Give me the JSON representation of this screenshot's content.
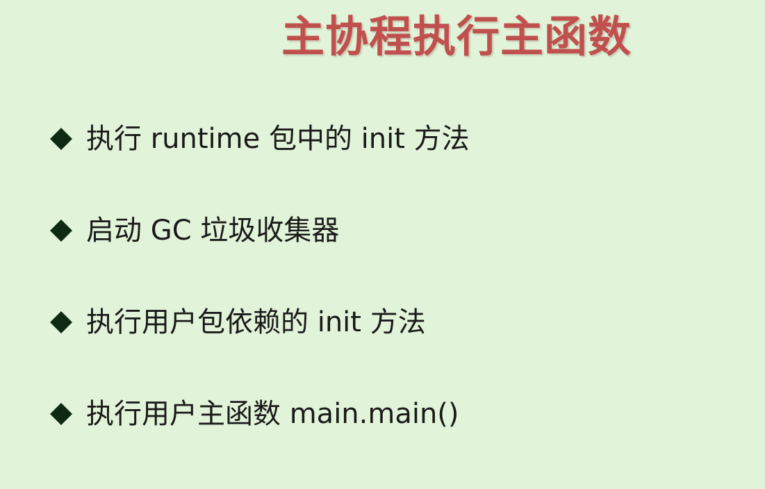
{
  "slide": {
    "title": "主协程执行主函数",
    "bullets": [
      {
        "icon": "diamond-bullet-icon",
        "text": "执行 runtime 包中的 init 方法"
      },
      {
        "icon": "diamond-bullet-icon",
        "text": "启动 GC 垃圾收集器"
      },
      {
        "icon": "diamond-bullet-icon",
        "text": "执行用户包依赖的 init 方法"
      },
      {
        "icon": "diamond-bullet-icon",
        "text": "执行用户主函数 main.main()"
      }
    ]
  },
  "colors": {
    "background": "#e1f4d9",
    "title": "#c0504d",
    "bullet_text": "#1a1a1a",
    "bullet_icon": "#0f2a12"
  }
}
